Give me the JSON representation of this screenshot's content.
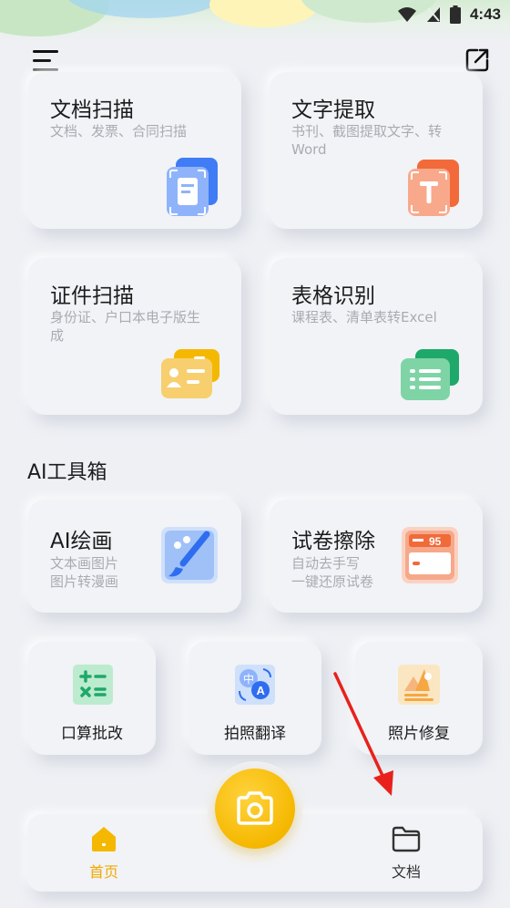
{
  "status_bar": {
    "time": "4:43",
    "icons": [
      "wifi-icon",
      "signal-icon",
      "battery-icon"
    ]
  },
  "header": {
    "menu_icon": "menu-icon",
    "share_icon": "share-icon"
  },
  "main_cards": [
    {
      "title": "文档扫描",
      "desc_lines": [
        "文档、发票、合同扫描"
      ],
      "icon": "document-scan-icon"
    },
    {
      "title": "文字提取",
      "desc_lines": [
        "书刊、截图提取文字、转",
        "Word"
      ],
      "icon": "text-extract-icon"
    },
    {
      "title": "证件扫描",
      "desc_lines": [
        "身份证、户口本电子版生",
        "成"
      ],
      "icon": "id-card-scan-icon"
    },
    {
      "title": "表格识别",
      "desc_lines": [
        "课程表、清单表转Excel"
      ],
      "icon": "table-recognize-icon"
    }
  ],
  "ai_section": {
    "title": "AI工具箱",
    "cards": [
      {
        "title": "AI绘画",
        "desc_lines": [
          "文本画图片",
          "图片转漫画"
        ],
        "icon": "ai-painting-icon"
      },
      {
        "title": "试卷擦除",
        "desc_lines": [
          "自动去手写",
          "一键还原试卷"
        ],
        "icon": "exam-erase-icon",
        "badge": "95"
      }
    ],
    "small_tools": [
      {
        "label": "口算批改",
        "icon": "math-check-icon"
      },
      {
        "label": "拍照翻译",
        "icon": "photo-translate-icon",
        "glyphs": [
          "中",
          "A"
        ]
      },
      {
        "label": "照片修复",
        "icon": "photo-restore-icon"
      }
    ]
  },
  "bottom_nav": {
    "items": [
      {
        "label": "首页",
        "icon": "home-icon",
        "active": true
      },
      {
        "label": "文档",
        "icon": "folder-icon",
        "active": false
      }
    ],
    "camera_icon": "camera-icon"
  },
  "colors": {
    "accent": "#f5b800",
    "active_nav": "#f2a900",
    "card_bg": "#f2f3f6",
    "arrow": "#e8211c"
  }
}
